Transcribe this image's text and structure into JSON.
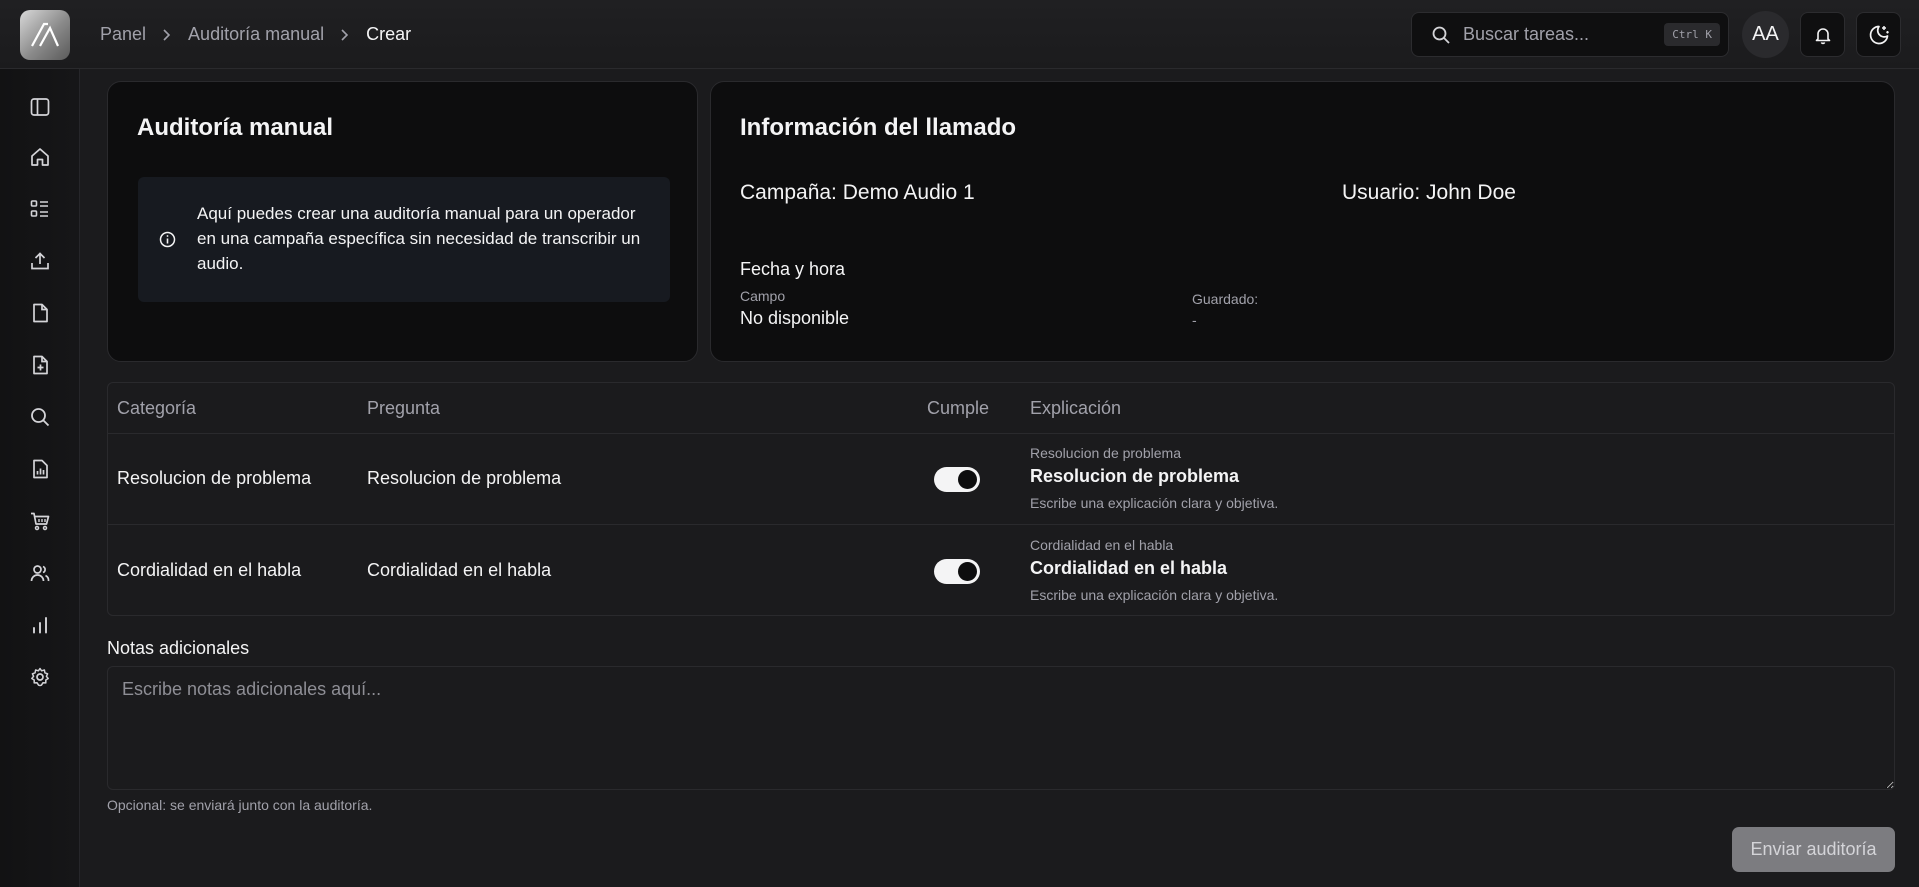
{
  "header": {
    "breadcrumbs": [
      "Panel",
      "Auditoría manual",
      "Crear"
    ],
    "search": {
      "placeholder": "Buscar tareas...",
      "shortcut": "Ctrl K"
    },
    "avatar_initials": "AA"
  },
  "sidebar": {
    "items": [
      {
        "icon": "sidebar-toggle-icon"
      },
      {
        "icon": "home-icon"
      },
      {
        "icon": "list-icon"
      },
      {
        "icon": "upload-icon"
      },
      {
        "icon": "file-icon"
      },
      {
        "icon": "file-plus-icon"
      },
      {
        "icon": "search-icon"
      },
      {
        "icon": "report-icon"
      },
      {
        "icon": "cart-icon"
      },
      {
        "icon": "users-icon"
      },
      {
        "icon": "bar-chart-icon"
      },
      {
        "icon": "settings-icon"
      }
    ]
  },
  "audit_card": {
    "title": "Auditoría manual",
    "info": "Aquí puedes crear una auditoría manual para un operador en una campaña específica sin necesidad de transcribir un audio."
  },
  "call_info": {
    "title": "Información del llamado",
    "campaign": "Campaña: Demo Audio 1",
    "user": "Usuario: John Doe",
    "datetime_label": "Fecha y hora",
    "field_label": "Campo",
    "field_value": "No disponible",
    "saved_label": "Guardado:",
    "saved_value": "-"
  },
  "table": {
    "headers": {
      "category": "Categoría",
      "question": "Pregunta",
      "complies": "Cumple",
      "explanation": "Explicación"
    },
    "rows": [
      {
        "category": "Resolucion de problema",
        "question": "Resolucion de problema",
        "complies": true,
        "exp_category": "Resolucion de problema",
        "exp_title": "Resolucion de problema",
        "exp_hint": "Escribe una explicación clara y objetiva."
      },
      {
        "category": "Cordialidad en el habla",
        "question": "Cordialidad en el habla",
        "complies": true,
        "exp_category": "Cordialidad en el habla",
        "exp_title": "Cordialidad en el habla",
        "exp_hint": "Escribe una explicación clara y objetiva."
      }
    ]
  },
  "notes": {
    "label": "Notas adicionales",
    "placeholder": "Escribe notas adicionales aquí...",
    "hint": "Opcional: se enviará junto con la auditoría."
  },
  "submit_label": "Enviar auditoría",
  "colors": {
    "background": "#1b1b1d",
    "card": "#0d0d0e",
    "info_box": "#171a20",
    "submit_disabled": "#7c7c80"
  }
}
